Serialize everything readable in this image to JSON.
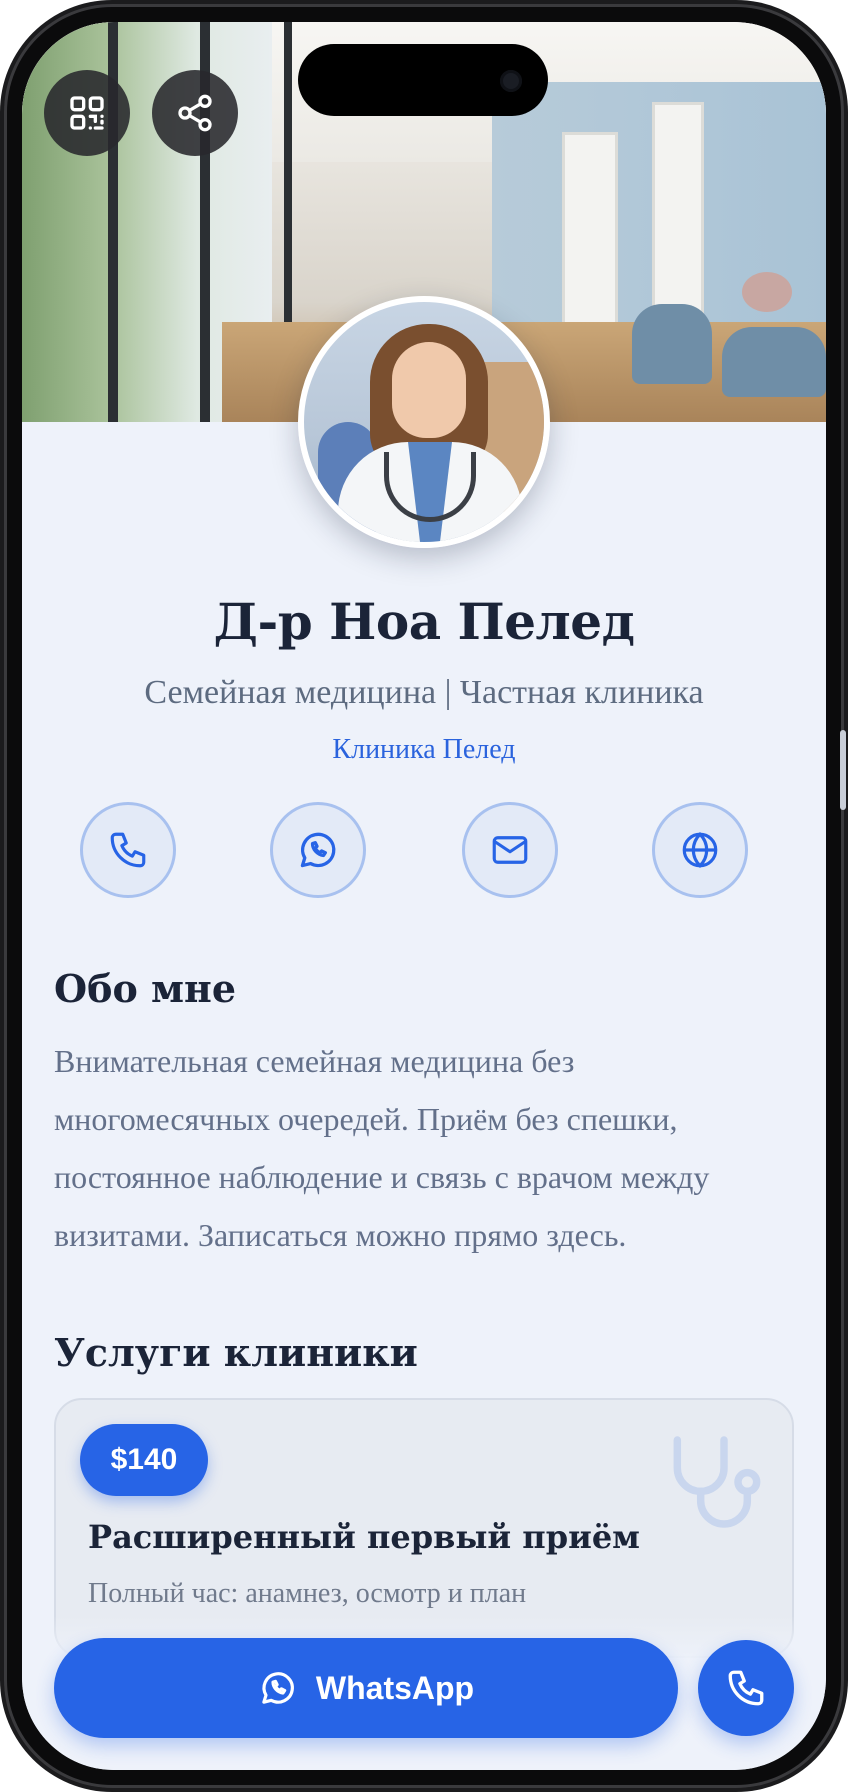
{
  "profile": {
    "name": "Д-р Ноа Пелед",
    "subtitle": "Семейная медицина | Частная клиника",
    "clinic": "Клиника Пелед"
  },
  "quick_actions": [
    {
      "icon": "phone-icon"
    },
    {
      "icon": "whatsapp-icon"
    },
    {
      "icon": "mail-icon"
    },
    {
      "icon": "globe-icon"
    }
  ],
  "about": {
    "heading": "Обо мне",
    "text": "Внимательная семейная медицина без многомесячных очередей. Приём без спешки, постоянное наблюдение и связь с врачом между визитами. Записаться можно прямо здесь."
  },
  "services": {
    "heading": "Услуги клиники",
    "items": [
      {
        "price": "$140",
        "title": "Расширенный первый приём",
        "description": "Полный час: анамнез, осмотр и план",
        "icon": "stethoscope-icon"
      }
    ]
  },
  "bottom_bar": {
    "whatsapp_label": "WhatsApp"
  },
  "colors": {
    "accent": "#2764e6",
    "page_background": "#eef2fa",
    "heading": "#1b2438",
    "muted_text": "#63708a"
  }
}
